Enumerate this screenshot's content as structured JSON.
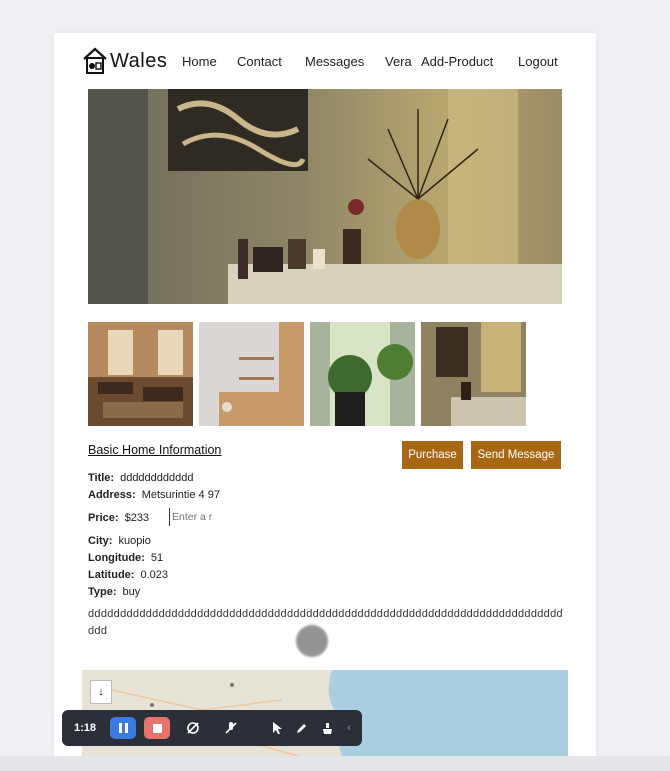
{
  "brand": {
    "name": "Wales",
    "logo_icon": "house-icon"
  },
  "nav": {
    "links": [
      "Home",
      "Contact",
      "Messages",
      "Vera",
      "Add-Product",
      "Logout"
    ]
  },
  "property": {
    "section_title": "Basic Home Information",
    "purchase_label": "Purchase",
    "send_message_label": "Send Message",
    "fields": {
      "title_label": "Title:",
      "title_value": "dddddddddddd",
      "address_label": "Address:",
      "address_value": "Metsurintie 4 97",
      "price_label": "Price:",
      "price_value": "$233",
      "price_input_placeholder": "Enter a r",
      "city_label": "City:",
      "city_value": "kuopio",
      "longitude_label": "Longitude:",
      "longitude_value": "51",
      "latitude_label": "Latitude:",
      "latitude_value": "0.023",
      "type_label": "Type:",
      "type_value": "buy"
    },
    "description": "ddddddddddddddddddddddddddddddddddddddddddddddddddddddddddddddddddddddddddddd"
  },
  "map": {
    "zoom_control_icon": "arrow-down-icon"
  },
  "recorder_toolbar": {
    "time": "1:18",
    "icons": [
      "pause-icon",
      "stop-icon",
      "camera-off-icon",
      "mic-off-icon",
      "pointer-icon",
      "pen-icon",
      "highlighter-icon",
      "chevron-left-icon"
    ]
  },
  "colors": {
    "accent": "#a86712",
    "toolbar_bg": "#2b2f38"
  }
}
